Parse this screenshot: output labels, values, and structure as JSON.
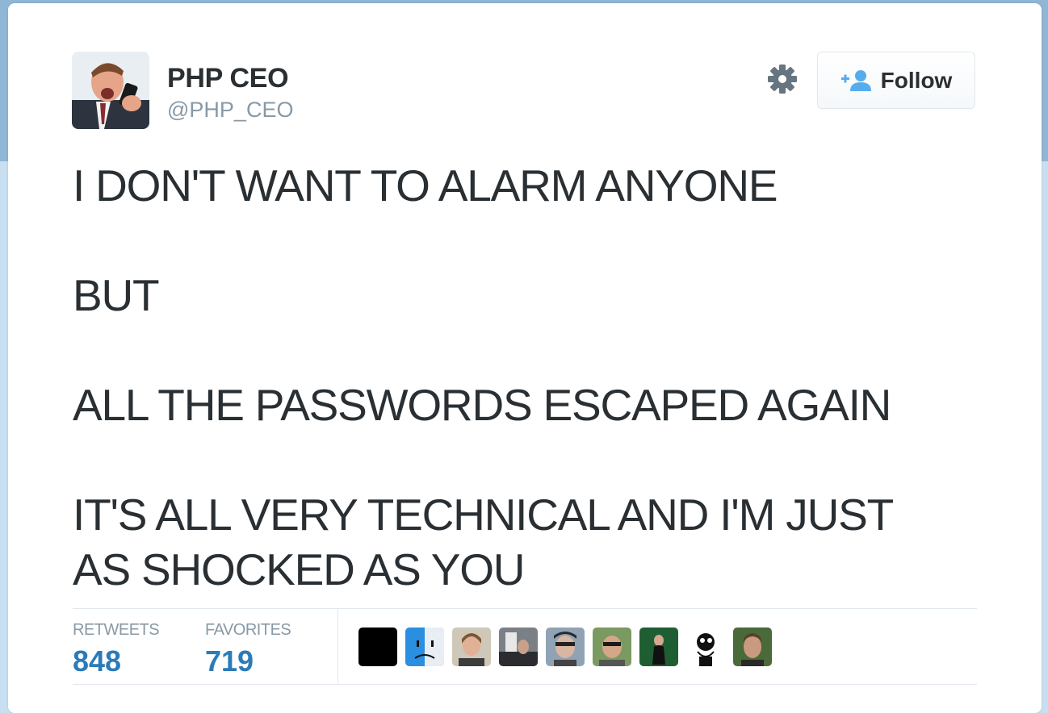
{
  "tweet": {
    "author": {
      "name": "PHP CEO",
      "handle": "@PHP_CEO"
    },
    "follow_label": "Follow",
    "lines": [
      "I DON'T WANT TO ALARM ANYONE",
      "BUT",
      "ALL THE PASSWORDS ESCAPED AGAIN",
      "IT'S ALL VERY TECHNICAL AND I'M JUST",
      "AS SHOCKED AS YOU"
    ],
    "stats": {
      "retweets_label": "RETWEETS",
      "retweets_value": "848",
      "favorites_label": "FAVORITES",
      "favorites_value": "719"
    }
  },
  "colors": {
    "accent": "#2b7bb9",
    "follow_icon": "#55acee",
    "muted": "#8899a6",
    "text": "#292f33"
  },
  "icons": [
    "gear-icon",
    "follow-person-icon"
  ]
}
